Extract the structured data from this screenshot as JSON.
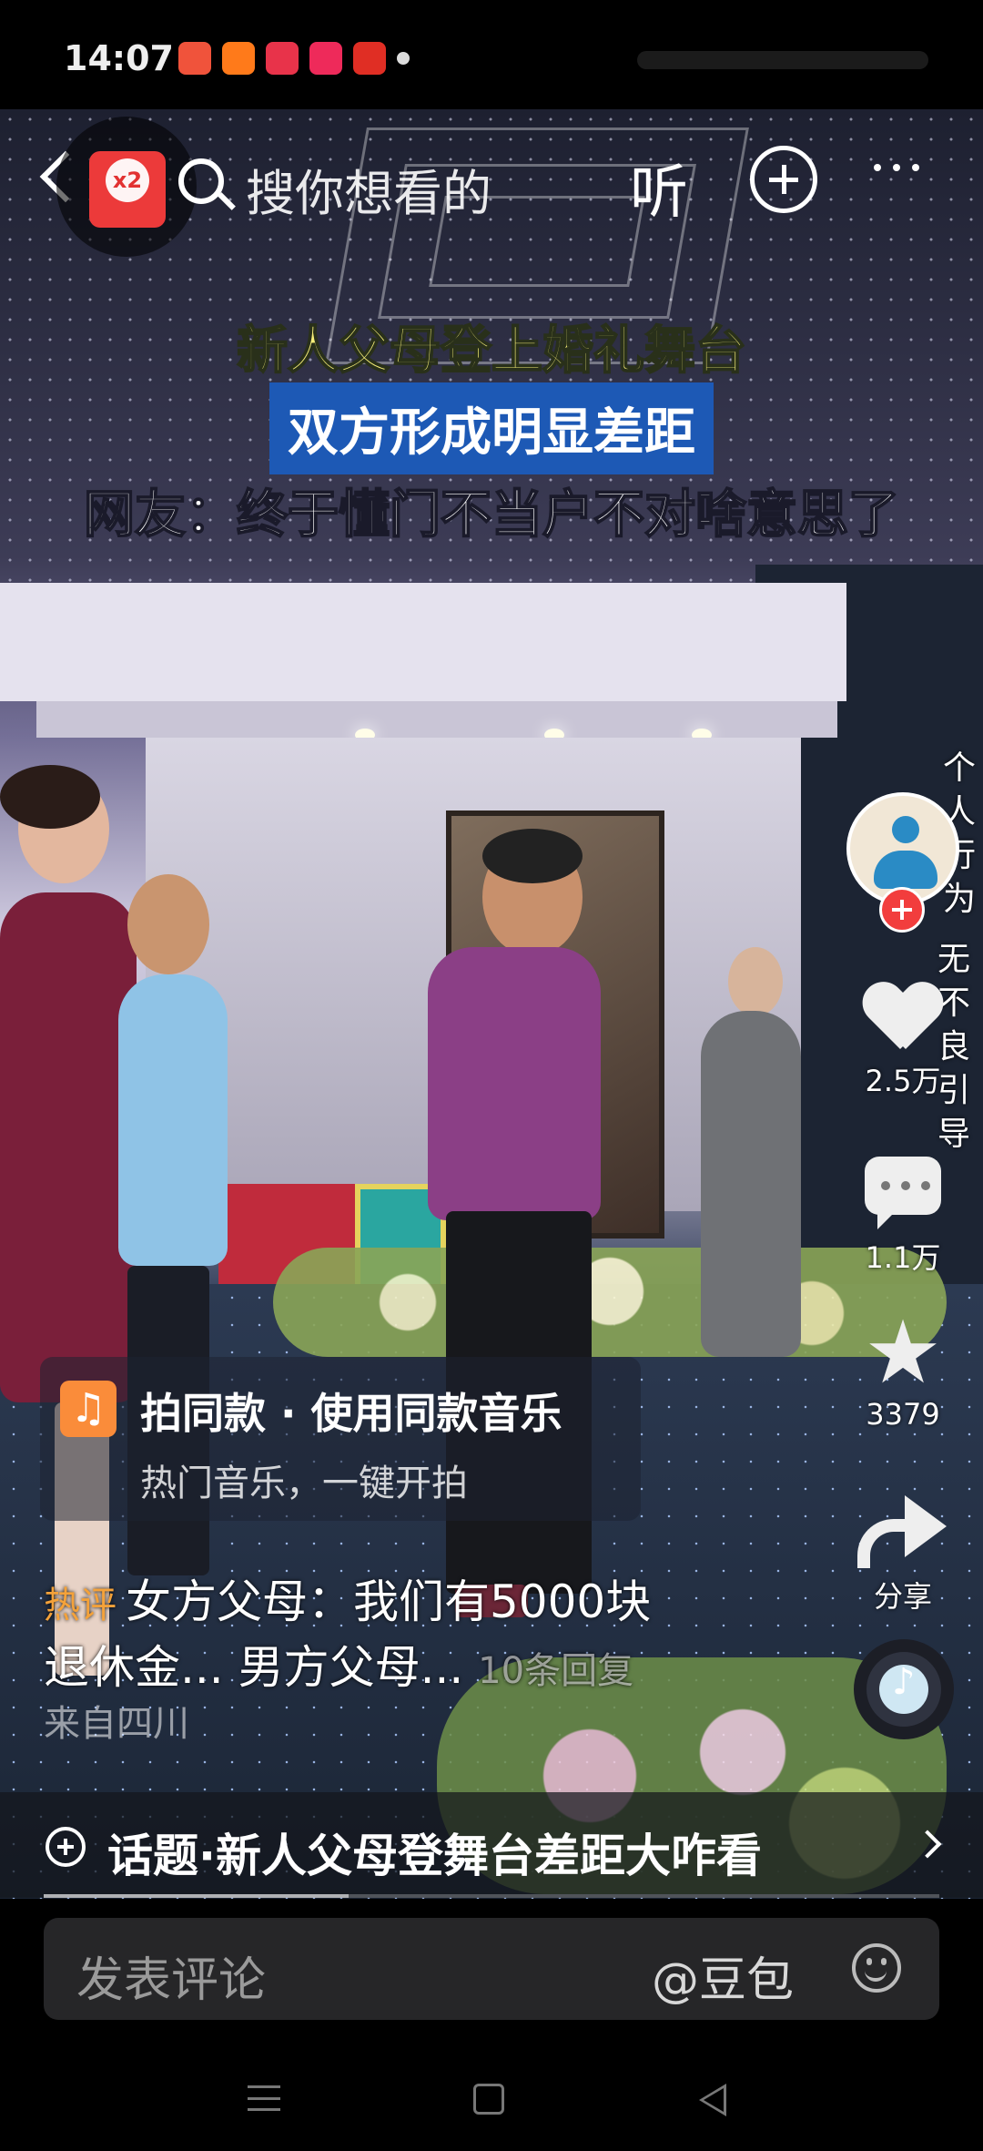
{
  "status_bar": {
    "time": "14:07",
    "apps": [
      {
        "icon": "video-app-icon",
        "color": "#f0533b"
      },
      {
        "icon": "taobao-app-icon",
        "color": "#ff7a1a"
      },
      {
        "icon": "game-app-icon",
        "color": "#e8334a"
      },
      {
        "icon": "douyin-app-icon",
        "color": "#ee2a5a"
      },
      {
        "icon": "toutiao-app-icon",
        "color": "#e02e24"
      }
    ]
  },
  "top_bar": {
    "search_placeholder": "搜你想看的",
    "listen_label": "听",
    "red_packet_label": "x2"
  },
  "video": {
    "headline_1": "新人父母登上婚礼舞台",
    "headline_2": "双方形成明显差距",
    "headline_3": "网友：终于懂门不当户不对啥意思了"
  },
  "notice": {
    "col1": "个人行为",
    "col2": "无不良引导"
  },
  "actions": {
    "likes": "2.5万",
    "comments": "1.1万",
    "favorites": "3379",
    "share_label": "分享"
  },
  "music_card": {
    "title": "拍同款 · 使用同款音乐",
    "subtitle": "热门音乐，一键开拍"
  },
  "hot_comment": {
    "tag": "热评",
    "text_line1": "女方父母：我们有5000块",
    "text_line2": "退休金... 男方父母...",
    "reply_count": "10条回复",
    "location": "来自四川"
  },
  "topic": {
    "text": "话题·新人父母登舞台差距大咋看"
  },
  "progress": {
    "fraction": 0.34
  },
  "comment_bar": {
    "placeholder": "发表评论",
    "mention": "@豆包"
  },
  "colors": {
    "accent_red": "#f23d3d",
    "headline_yellow": "#f6ee79",
    "headline_blue": "#1d59b5",
    "hot_tag": "#f4a23a"
  }
}
